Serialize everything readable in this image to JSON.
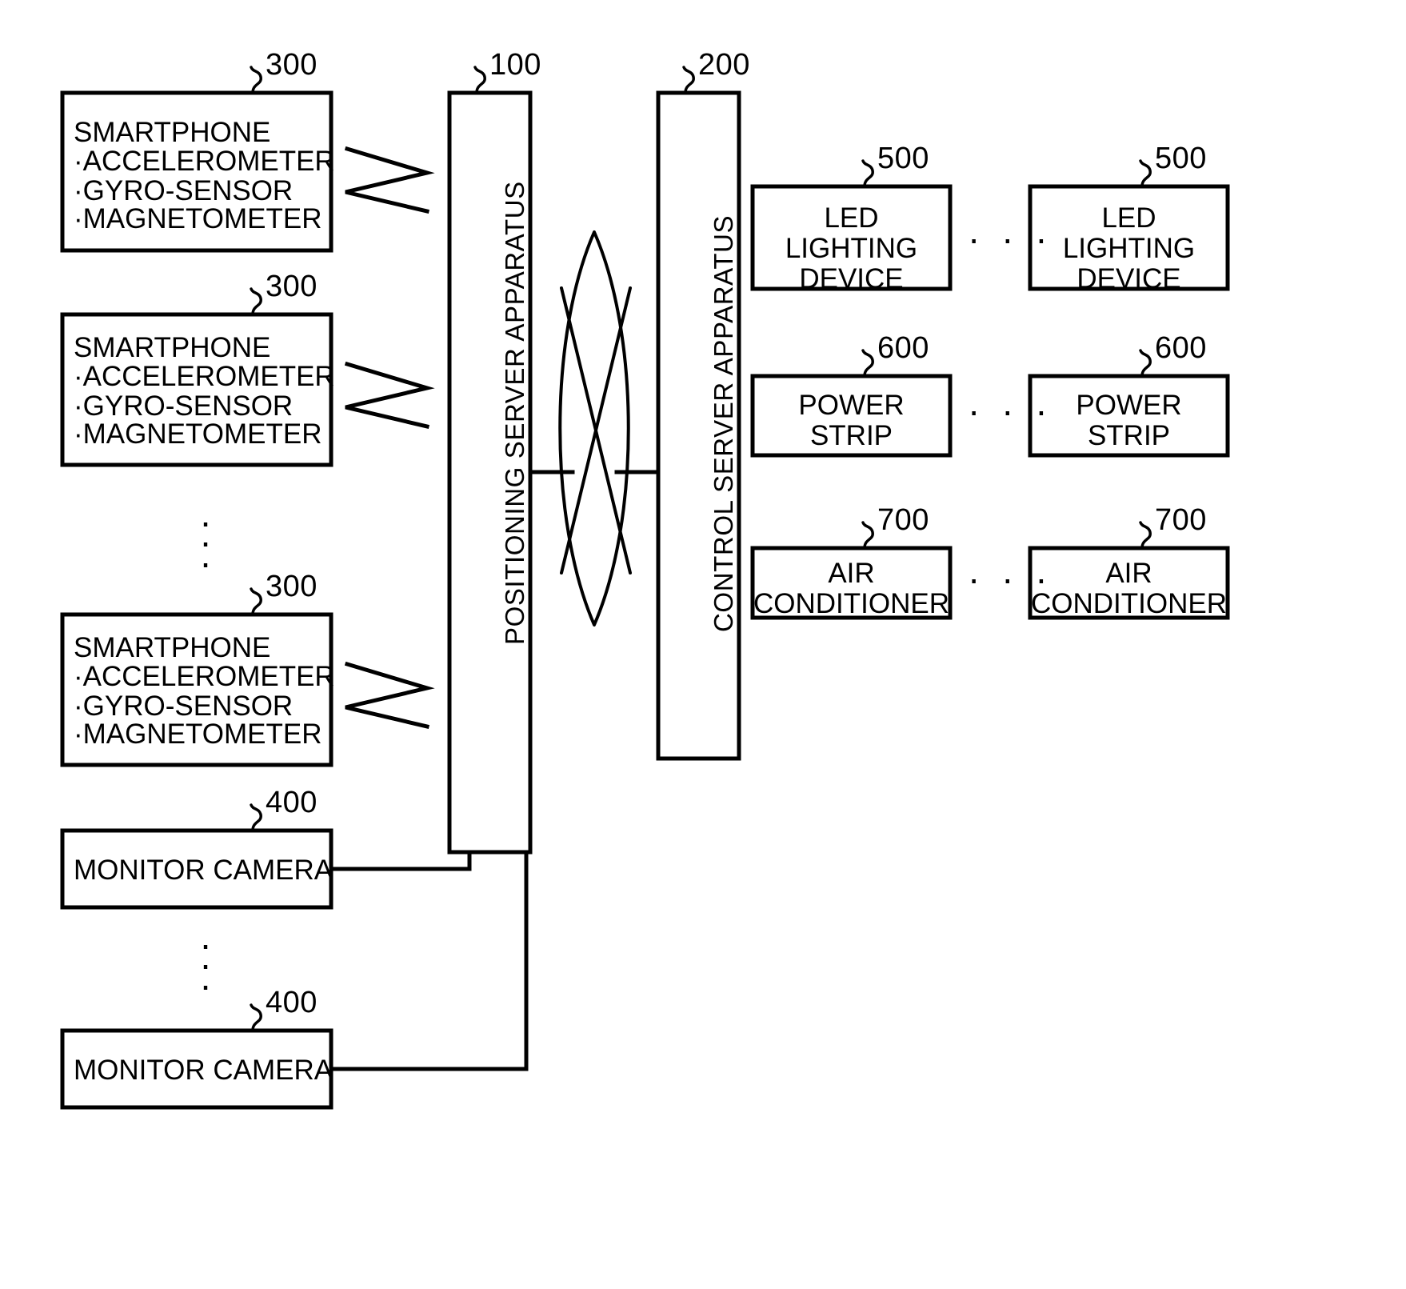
{
  "figure": {
    "type": "patent-block-diagram",
    "background": "#ffffff",
    "line_color": "#000000"
  },
  "reference_numerals": {
    "smartphone": "300",
    "positioning_server": "100",
    "control_server": "200",
    "monitor_camera": "400",
    "led_lighting": "500",
    "power_strip": "600",
    "air_conditioner": "700"
  },
  "smartphones": [
    {
      "title": "SMARTPHONE",
      "items": [
        "·ACCELEROMETER",
        "·GYRO-SENSOR",
        "·MAGNETOMETER"
      ],
      "ref": "300"
    },
    {
      "title": "SMARTPHONE",
      "items": [
        "·ACCELEROMETER",
        "·GYRO-SENSOR",
        "·MAGNETOMETER"
      ],
      "ref": "300"
    },
    {
      "title": "SMARTPHONE",
      "items": [
        "·ACCELEROMETER",
        "·GYRO-SENSOR",
        "·MAGNETOMETER"
      ],
      "ref": "300"
    }
  ],
  "monitor_cameras": [
    {
      "label": "MONITOR CAMERA",
      "ref": "400"
    },
    {
      "label": "MONITOR CAMERA",
      "ref": "400"
    }
  ],
  "servers": {
    "positioning": {
      "label": "POSITIONING SERVER APPARATUS",
      "ref": "100"
    },
    "control": {
      "label": "CONTROL SERVER APPARATUS",
      "ref": "200"
    }
  },
  "network": {
    "icon": "network-cloud-icon",
    "label": ""
  },
  "devices": {
    "led": {
      "ref": "500",
      "line1": "LED",
      "line2": "LIGHTING",
      "line3": "DEVICE",
      "first_label": "LED\nLIGHTING\nDEVICE",
      "last_label": "LED\nLIGHTING\nDEVICE"
    },
    "power": {
      "ref": "600",
      "line1": "POWER",
      "line2": "STRIP",
      "first_label": "POWER\nSTRIP",
      "last_label": "POWER\nSTRIP"
    },
    "air": {
      "ref": "700",
      "line1": "AIR",
      "line2": "CONDITIONER",
      "first_label": "AIR\nCONDITIONER",
      "last_label": "AIR\nCONDITIONER"
    }
  },
  "ellipses": {
    "horizontal": "· · ·",
    "vertical": "·\n·\n·"
  }
}
